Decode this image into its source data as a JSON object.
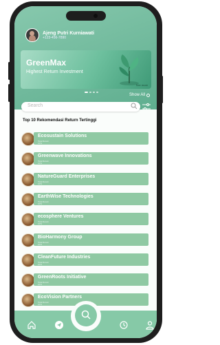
{
  "profile": {
    "name": "Ajeng Putri Kurniawati",
    "phone": "+123-456-7890"
  },
  "banner": {
    "title": "GreenMax",
    "subtitle": "Highest Return Investment",
    "link": "See more"
  },
  "carousel": {
    "active": 1,
    "count": 4
  },
  "show_all": "Show All",
  "search": {
    "placeholder": "Search"
  },
  "list_title": "Top 10 Rekomendasi Return Tertinggi",
  "companies": [
    {
      "name": "Ecosustain  Solutions",
      "meta1": "Total Return",
      "meta2": "10%"
    },
    {
      "name": "Greenwave Innovations",
      "meta1": "Total Return",
      "meta2": "10%"
    },
    {
      "name": "NatureGuard Enterprises",
      "meta1": "Total Return",
      "meta2": "10%"
    },
    {
      "name": "EarthWise Technologies",
      "meta1": "Total Return",
      "meta2": "10%"
    },
    {
      "name": "ecosphere Ventures",
      "meta1": "Total Return",
      "meta2": "10%"
    },
    {
      "name": "BioHarmony Group",
      "meta1": "Total Return",
      "meta2": "10%"
    },
    {
      "name": "CleanFuture Industries",
      "meta1": "Total Return",
      "meta2": "10%"
    },
    {
      "name": "GreenRoots Initiative",
      "meta1": "Total Return",
      "meta2": "10%"
    },
    {
      "name": "EcoVision Partners",
      "meta1": "Total Return",
      "meta2": "10%"
    }
  ],
  "tabs": [
    {
      "icon": "home-icon"
    },
    {
      "icon": "send-icon"
    },
    {
      "icon": "search-icon"
    },
    {
      "icon": "history-icon"
    },
    {
      "icon": "user-icon"
    }
  ],
  "colors": {
    "brand": "#86c9a7",
    "card": "#8fc9a3",
    "frame": "#1e1e1e"
  }
}
